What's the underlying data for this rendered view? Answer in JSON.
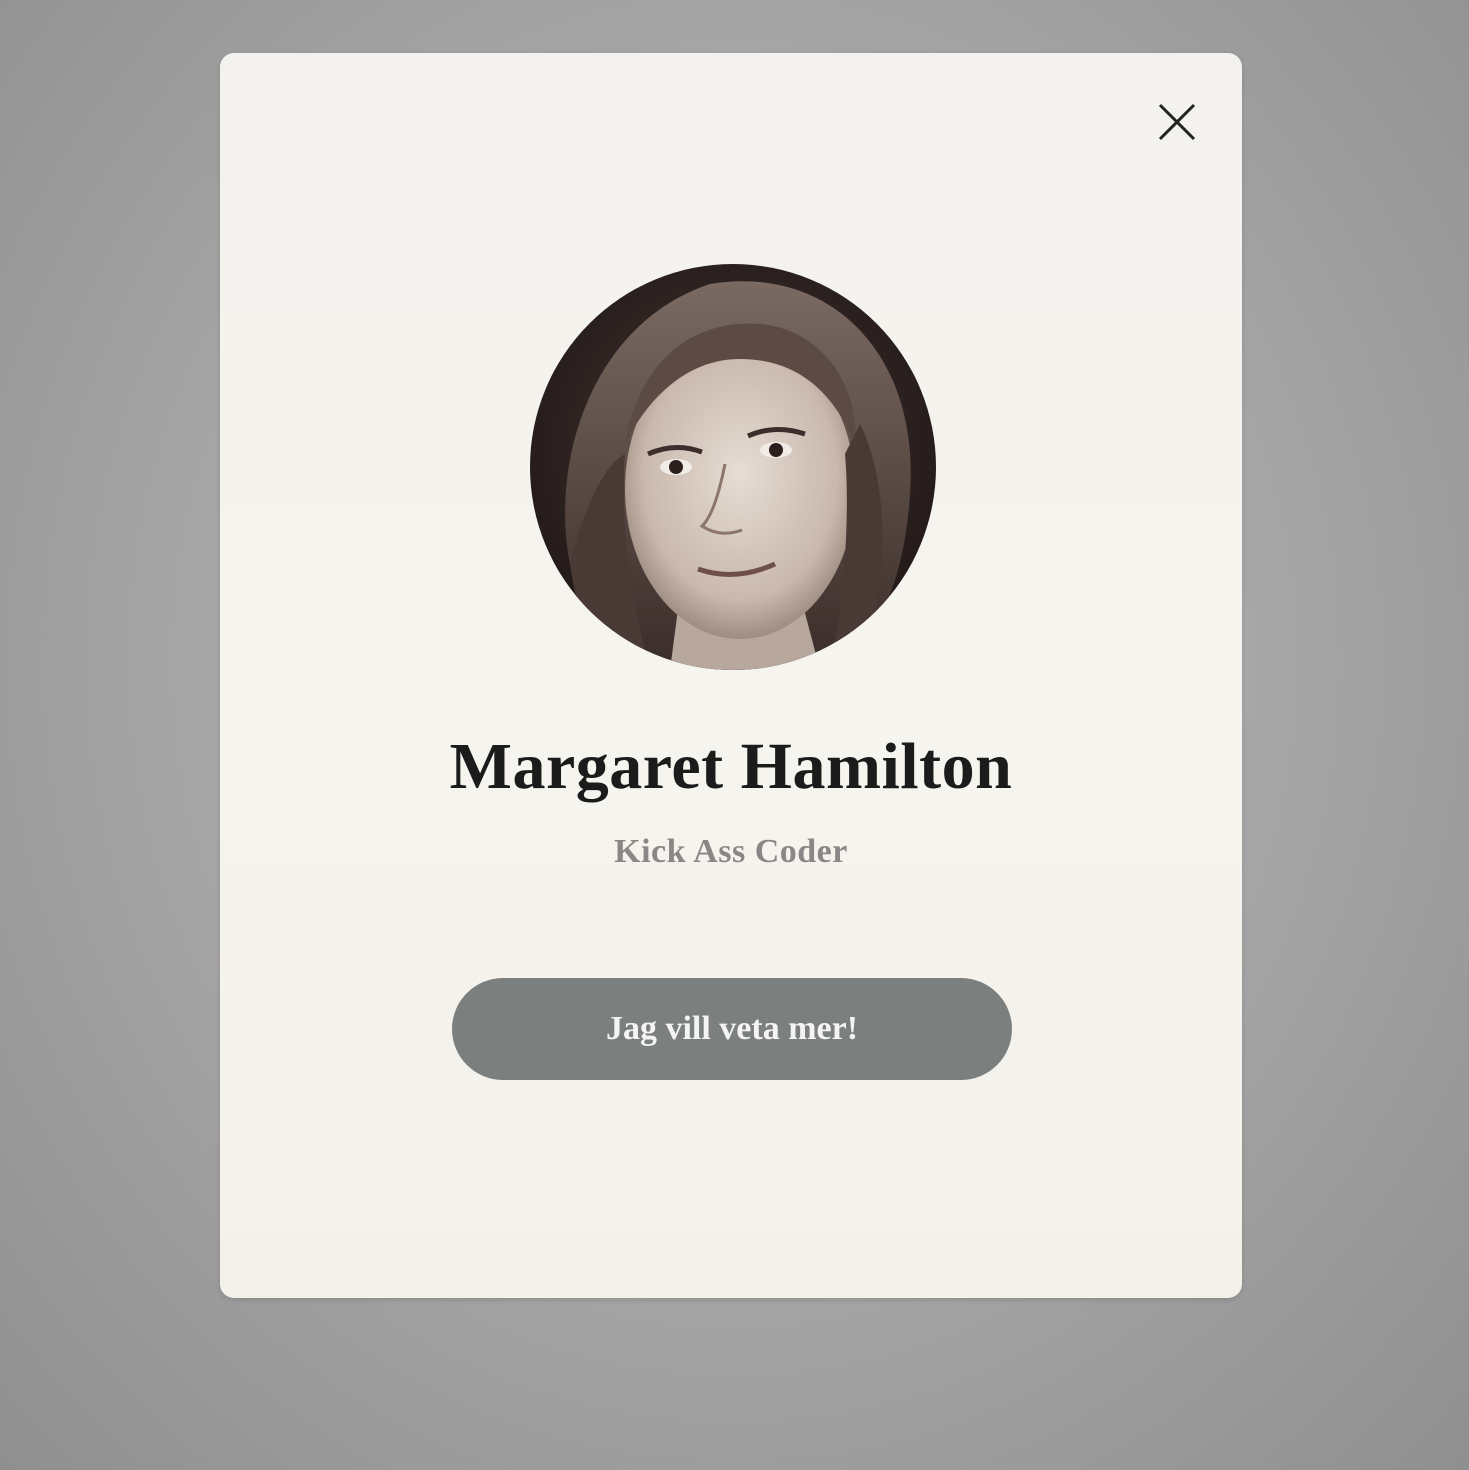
{
  "dialog": {
    "close_icon": "close-icon",
    "avatar_icon": "portrait-photo",
    "name": "Margaret Hamilton",
    "title": "Kick Ass Coder",
    "cta_label": "Jag vill veta mer!"
  },
  "colors": {
    "background": "#a9a9a9",
    "card": "#f5f3ee",
    "name_text": "#1b1b1b",
    "title_text": "#8a8886",
    "button": "#7b7f7d",
    "button_text": "#f4f4f2"
  }
}
